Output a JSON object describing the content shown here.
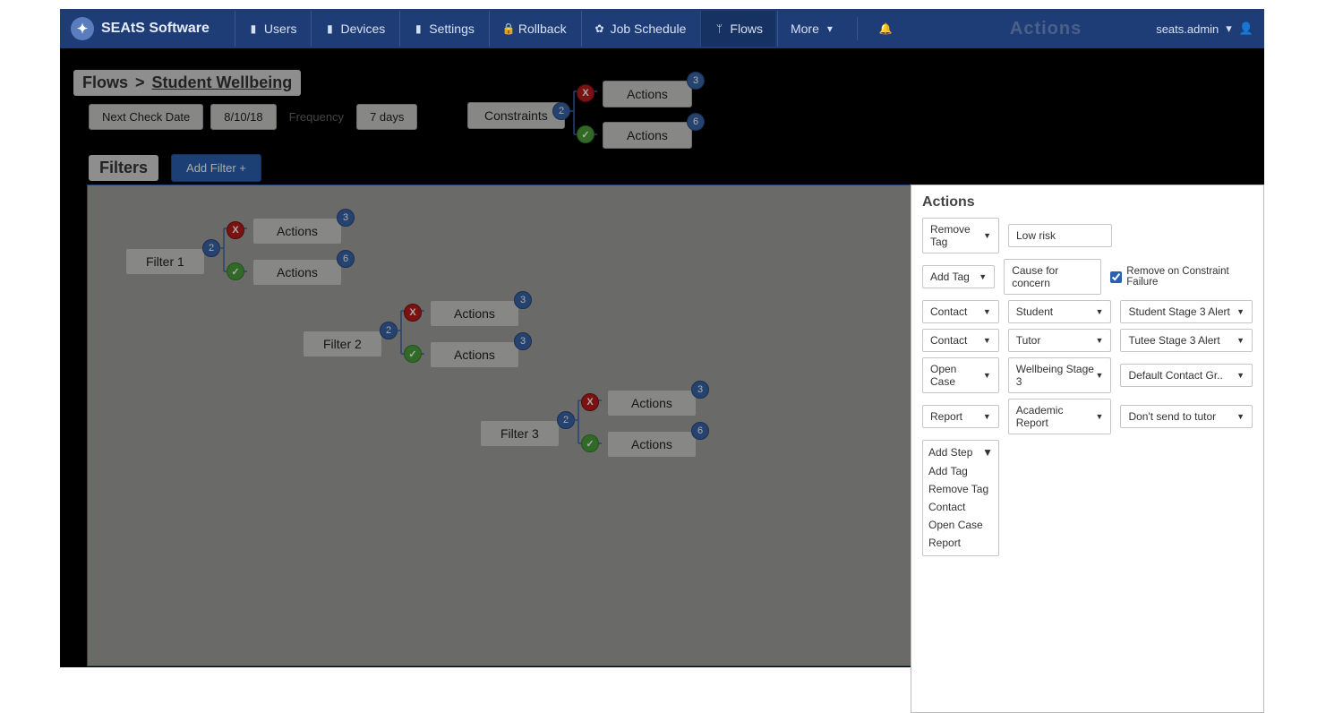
{
  "brand": "SEAtS Software",
  "nav": {
    "users": "Users",
    "devices": "Devices",
    "settings": "Settings",
    "rollback": "Rollback",
    "job_schedule": "Job Schedule",
    "flows": "Flows",
    "more": "More"
  },
  "ghost_heading": "Actions",
  "user": {
    "name": "seats.admin"
  },
  "breadcrumb": {
    "root": "Flows",
    "sep": ">",
    "current": "Student Wellbeing"
  },
  "schedule": {
    "next_check_label": "Next Check Date",
    "next_check_value": "8/10/18",
    "frequency_label": "Frequency",
    "frequency_value": "7 days"
  },
  "constraints_row": {
    "constraints": "Constraints",
    "constraints_badge": "2",
    "fail_badge": "3",
    "fail_label": "Actions",
    "pass_badge": "6",
    "pass_label": "Actions"
  },
  "filters_hdr": {
    "label": "Filters",
    "add_btn": "Add Filter +"
  },
  "flows": [
    {
      "name": "Filter 1",
      "badge": "2",
      "fail_badge": "3",
      "fail_label": "Actions",
      "pass_badge": "6",
      "pass_label": "Actions"
    },
    {
      "name": "Filter 2",
      "badge": "2",
      "fail_badge": "3",
      "fail_label": "Actions",
      "pass_badge": "3",
      "pass_label": "Actions"
    },
    {
      "name": "Filter 3",
      "badge": "2",
      "fail_badge": "3",
      "fail_label": "Actions",
      "pass_badge": "6",
      "pass_label": "Actions"
    }
  ],
  "panel": {
    "title": "Actions",
    "rows": [
      {
        "type": "Remove Tag",
        "val1": "Low risk"
      },
      {
        "type": "Add Tag",
        "val1": "Cause for concern",
        "remove_chk": "Remove on Constraint Failure"
      },
      {
        "type": "Contact",
        "val1": "Student",
        "val2": "Student Stage 3 Alert"
      },
      {
        "type": "Contact",
        "val1": "Tutor",
        "val2": "Tutee Stage 3 Alert"
      },
      {
        "type": "Open Case",
        "val1": "Wellbeing Stage 3",
        "val2": "Default Contact Gr.."
      },
      {
        "type": "Report",
        "val1": "Academic Report",
        "val2": "Don't send to tutor"
      }
    ],
    "add_step": {
      "label": "Add Step",
      "options": [
        "Add Tag",
        "Remove Tag",
        "Contact",
        "Open Case",
        "Report"
      ]
    }
  }
}
